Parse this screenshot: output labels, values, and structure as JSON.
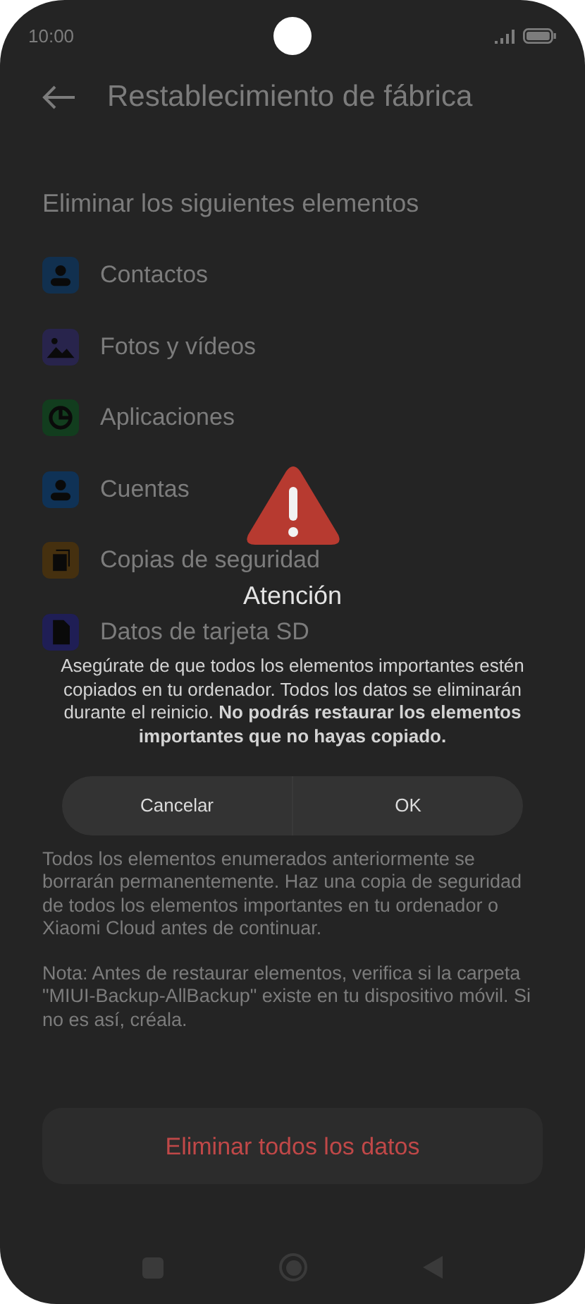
{
  "status_bar": {
    "time": "10:00"
  },
  "header": {
    "title": "Restablecimiento de fábrica"
  },
  "section": {
    "title": "Eliminar los siguientes elementos",
    "items": [
      {
        "label": "Contactos",
        "kind": "person",
        "color": "#11304f"
      },
      {
        "label": "Fotos y vídeos",
        "kind": "image",
        "color": "#28244c"
      },
      {
        "label": "Aplicaciones",
        "kind": "pie",
        "color": "#123d1e"
      },
      {
        "label": "Cuentas",
        "kind": "person",
        "color": "#0f3256"
      },
      {
        "label": "Copias de seguridad",
        "kind": "copy",
        "color": "#45300f"
      },
      {
        "label": "Datos de tarjeta SD",
        "kind": "sd",
        "color": "#1f1e55"
      }
    ]
  },
  "warning": "Todos los elementos enumerados anteriormente se borrarán permanentemente. Haz una copia de seguridad de todos los elementos importantes en tu ordenador o Xiaomi Cloud antes de continuar.",
  "note": "Nota: Antes de restaurar elementos, verifica si la carpeta \"MIUI-Backup-AllBackup\" existe en tu dispositivo móvil. Si no es así, créala.",
  "erase_button": "Eliminar todos los datos",
  "dialog": {
    "title": "Atención",
    "message": "Asegúrate de que todos los elementos importantes estén copiados en tu ordenador. Todos los datos se eliminarán durante el reinicio. **No podrás restaurar los elementos importantes que no hayas copiado.**",
    "buttons": [
      "Cancelar",
      "OK"
    ]
  }
}
